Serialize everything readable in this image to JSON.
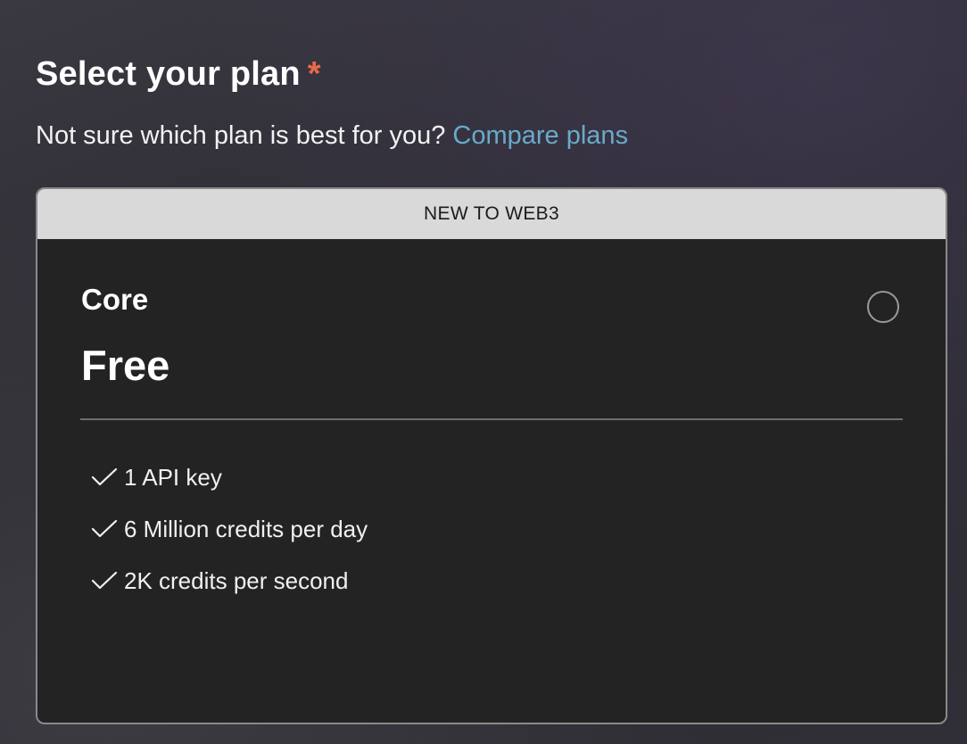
{
  "heading": {
    "title": "Select your plan",
    "required_marker": "*"
  },
  "subtitle": {
    "text": "Not sure which plan is best for you?",
    "link_label": "Compare plans"
  },
  "plan": {
    "banner": "NEW TO WEB3",
    "name": "Core",
    "price": "Free",
    "selected": false,
    "features": [
      {
        "icon": "check-icon",
        "label": "1 API key"
      },
      {
        "icon": "check-icon",
        "label": "6 Million credits per day"
      },
      {
        "icon": "check-icon",
        "label": "2K credits per second"
      }
    ]
  },
  "colors": {
    "accent_link": "#6aaac9",
    "required_star": "#e8694a",
    "card_background": "#232323",
    "banner_background": "#d9d9d9"
  }
}
